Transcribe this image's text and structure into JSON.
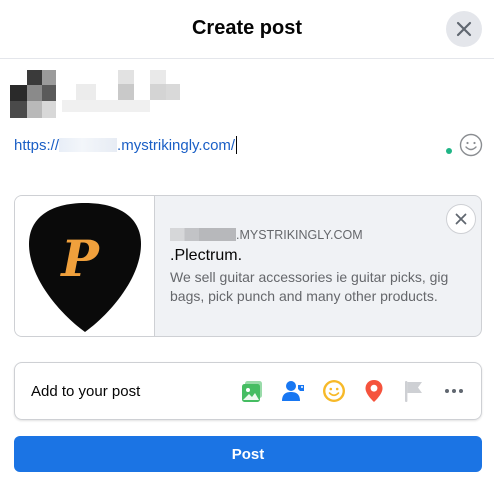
{
  "dialog": {
    "title": "Create post"
  },
  "composer": {
    "url_prefix": "https://",
    "url_suffix": ".mystrikingly.com/"
  },
  "link_preview": {
    "domain_suffix": ".MYSTRIKINGLY.COM",
    "title": ".Plectrum.",
    "description": "We sell guitar accessories ie guitar picks, gig bags, pick punch and many other products.",
    "logo_letter": "P"
  },
  "add_to_post": {
    "label": "Add to your post",
    "tools": [
      "photo-video-icon",
      "tag-people-icon",
      "feeling-activity-icon",
      "check-in-icon",
      "flag-icon",
      "more-icon"
    ]
  },
  "post_button": {
    "label": "Post"
  },
  "colors": {
    "primary": "#1b74e4",
    "link": "#1a5fc6",
    "photo_green": "#45bd62",
    "tag_blue": "#1877f2",
    "feeling_yellow": "#f7b928",
    "checkin_red": "#f5533d",
    "flag_gray": "#ced0d4",
    "pick_black": "#0a0a0a",
    "pick_letter_orange": "#f0a03c"
  }
}
